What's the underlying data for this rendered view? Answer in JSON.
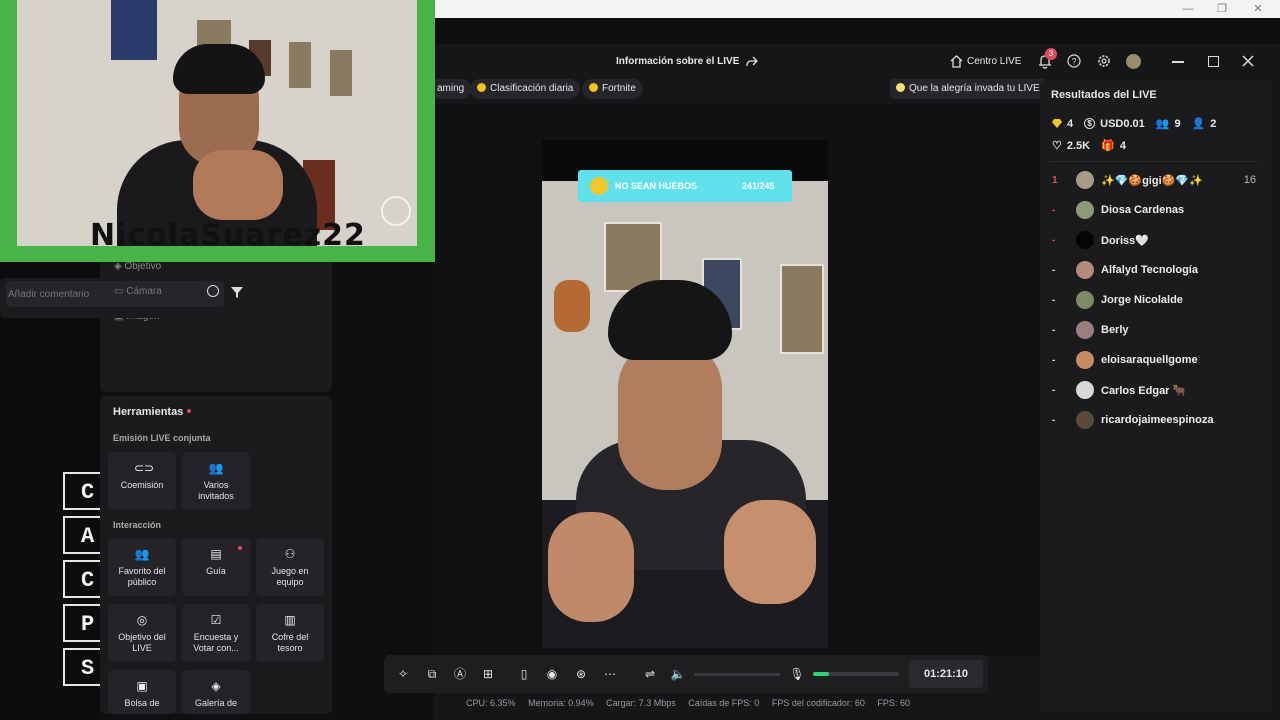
{
  "os": {
    "min": "—",
    "max": "❐",
    "close": "✕"
  },
  "background_letters": [
    "C",
    "A",
    "C",
    "P",
    "S"
  ],
  "topbar": {
    "title": "Información sobre el LIVE",
    "centro": "Centro LIVE",
    "notif_count": "3"
  },
  "pills": [
    "aming",
    "Clasificación diaria",
    "Fortnite"
  ],
  "tip": "Que la alegría invada tu LIVE",
  "stream": {
    "goal_text": "NO SEAN HUEBOS",
    "goal_progress": "241/245"
  },
  "results": {
    "title": "Resultados del LIVE",
    "diamonds": "4",
    "usd": "USD0.01",
    "viewers": "9",
    "followers": "2",
    "likes": "2.5K",
    "gifts": "4"
  },
  "viewers": [
    {
      "rank": "1",
      "name": "✨💎🍪gigi🍪💎✨",
      "score": "16"
    },
    {
      "rank": "-",
      "name": "Diosa Cardenas",
      "score": ""
    },
    {
      "rank": "-",
      "name": "Doriss🤍",
      "score": ""
    },
    {
      "rank": "-",
      "name": "Alfalyd Tecnología",
      "score": ""
    },
    {
      "rank": "-",
      "name": "Jorge Nicolalde",
      "score": ""
    },
    {
      "rank": "-",
      "name": "Berly",
      "score": ""
    },
    {
      "rank": "-",
      "name": "eloisaraquellgome",
      "score": ""
    },
    {
      "rank": "-",
      "name": "Carlos Edgar 🐂",
      "score": ""
    },
    {
      "rank": "-",
      "name": "ricardojaimeespinoza",
      "score": ""
    }
  ],
  "side_menu": {
    "objetivo": "Objetivo",
    "camara": "Cámara",
    "imagen": "Imagen"
  },
  "comment": {
    "placeholder": "Añadir comentario"
  },
  "webcam": {
    "overlay_name": "NicolaSuarez22"
  },
  "tools": {
    "title": "Herramientas",
    "section1": "Emisión LIVE conjunta",
    "section2": "Interacción",
    "tiles": [
      {
        "label": "Coemisión"
      },
      {
        "label": "Varios invitados"
      },
      {
        "label": "Favorito del público"
      },
      {
        "label": "Guía"
      },
      {
        "label": "Juego en equipo"
      },
      {
        "label": "Objetivo del LIVE"
      },
      {
        "label": "Encuesta y Votar con..."
      },
      {
        "label": "Cofre del tesoro"
      },
      {
        "label": "Bolsa de"
      },
      {
        "label": "Galería de"
      }
    ]
  },
  "bottom": {
    "timer": "01:21:10"
  },
  "stats": {
    "cpu_label": "CPU:",
    "cpu": "6.35%",
    "mem_label": "Memoria:",
    "mem": "0.94%",
    "load_label": "Cargar:",
    "load": "7.3 Mbps",
    "drops_label": "Caídas de FPS:",
    "drops": "0",
    "enc_label": "FPS del codificador:",
    "enc": "60",
    "fps_label": "FPS:",
    "fps": "60"
  },
  "colors": {
    "accent": "#e24a5c",
    "webcam_border": "#48b448",
    "goal": "#5fe0ea",
    "mic_level": "#2fd07a"
  }
}
